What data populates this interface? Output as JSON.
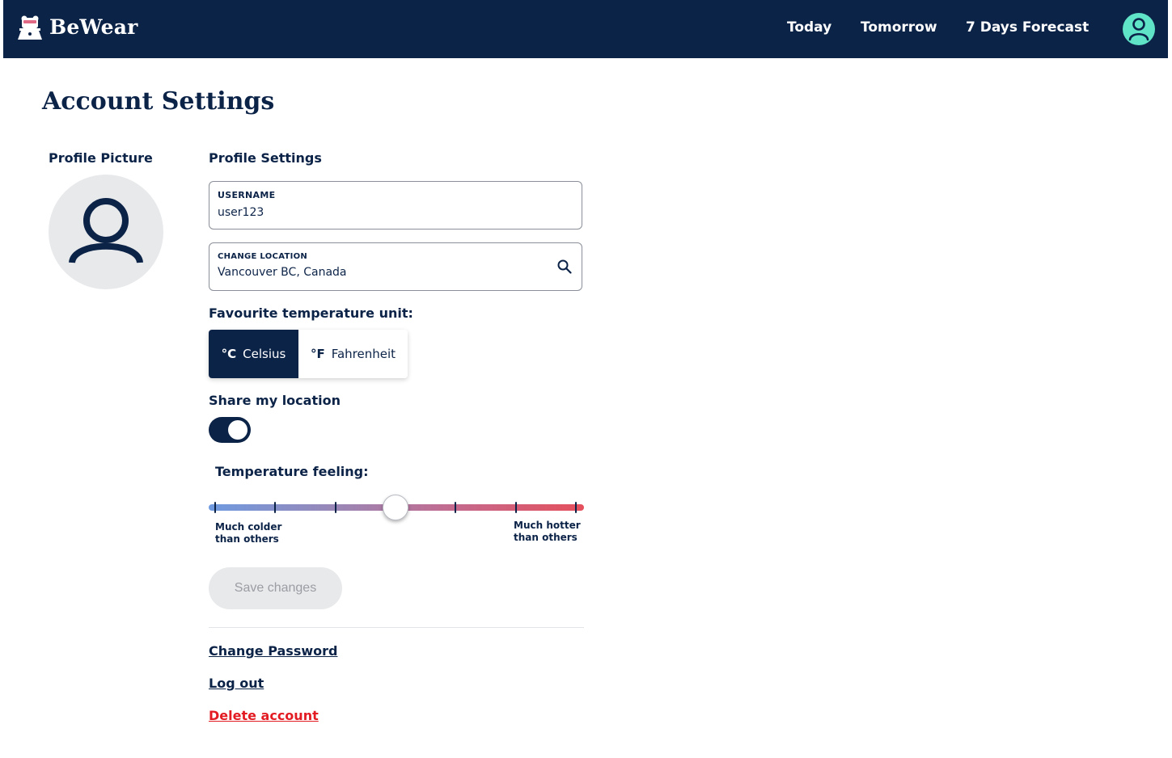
{
  "colors": {
    "navy": "#0c2348",
    "avatar_accent": "#5fe4c8",
    "danger": "#e31b23",
    "disabled_bg": "#e8e9eb"
  },
  "navbar": {
    "brand": "BeWear",
    "brand_icon": "bear-logo-icon",
    "links": [
      "Today",
      "Tomorrow",
      "7 Days Forecast"
    ],
    "avatar_icon": "user-avatar-icon"
  },
  "page": {
    "title": "Account Settings"
  },
  "profile_picture": {
    "label": "Profile Picture",
    "icon": "user-icon"
  },
  "profile_settings": {
    "label": "Profile Settings",
    "username": {
      "label": "USERNAME",
      "value": "user123"
    },
    "location": {
      "label": "CHANGE LOCATION",
      "value": "Vancouver BC, Canada",
      "icon": "search-icon"
    }
  },
  "temperature_unit": {
    "label": "Favourite temperature unit:",
    "options": [
      {
        "symbol": "°C",
        "label": "Celsius",
        "selected": true
      },
      {
        "symbol": "°F",
        "label": "Fahrenheit",
        "selected": false
      }
    ]
  },
  "share_location": {
    "label": "Share my location",
    "enabled": true
  },
  "temperature_feeling": {
    "label": "Temperature feeling:",
    "min_label": "Much colder\nthan others",
    "max_label": "Much hotter\nthan others",
    "steps": 7,
    "value_fraction": 0.5
  },
  "actions": {
    "save": "Save changes",
    "change_password": "Change Password",
    "log_out": "Log out",
    "delete_account": "Delete account"
  }
}
